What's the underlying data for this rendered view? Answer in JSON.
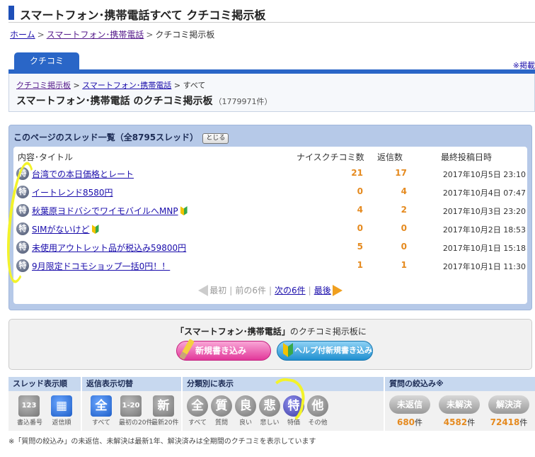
{
  "page": {
    "title": "スマートフォン･携帯電話すべて クチコミ掲示板"
  },
  "breadcrumb": {
    "home": "ホーム",
    "category": "スマートフォン･携帯電話",
    "current": "クチコミ掲示板",
    "sep": ">"
  },
  "tab": {
    "label": "クチコミ",
    "right_link": "※掲載"
  },
  "board": {
    "crumb_board": "クチコミ掲示板",
    "crumb_category": "スマートフォン･携帯電話",
    "crumb_all": "すべて",
    "title": "スマートフォン･携帯電話 のクチコミ掲示板",
    "count": "（1779971件）"
  },
  "thread_panel": {
    "title": "このページのスレッド一覧（全8795スレッド）",
    "close_label": "とじる",
    "headers": {
      "content": "内容･タイトル",
      "nice": "ナイスクチコミ数",
      "reply": "返信数",
      "last_post": "最終投稿日時"
    },
    "badge": "特",
    "threads": [
      {
        "title": "台湾での本日価格とレート",
        "beginner": false,
        "nice": "21",
        "reply": "17",
        "date": "2017年10月5日 23:10"
      },
      {
        "title": "イートレンド8580円",
        "beginner": false,
        "nice": "0",
        "reply": "4",
        "date": "2017年10月4日 07:47"
      },
      {
        "title": "秋葉原ヨドバシでワイモバイルへMNP",
        "beginner": true,
        "nice": "4",
        "reply": "2",
        "date": "2017年10月3日 23:20"
      },
      {
        "title": "SIMがないけど",
        "beginner": true,
        "nice": "0",
        "reply": "0",
        "date": "2017年10月2日 18:53"
      },
      {
        "title": "未使用アウトレット品が税込み59800円",
        "beginner": false,
        "nice": "5",
        "reply": "0",
        "date": "2017年10月1日 15:18"
      },
      {
        "title": "9月限定ドコモショップ一括0円！！",
        "beginner": false,
        "nice": "1",
        "reply": "1",
        "date": "2017年10月1日 11:30"
      }
    ],
    "pager": {
      "first": "最初",
      "prev": "前の6件",
      "next": "次の6件",
      "last": "最後",
      "sep": "|"
    }
  },
  "post_box": {
    "label_bold": "「スマートフォン･携帯電話」",
    "label_rest": "のクチコミ掲示板に",
    "new_post": "新規書き込み",
    "help_post": "ヘルプ付新規書き込み"
  },
  "toolbar": {
    "sort": {
      "head": "スレッド表示順",
      "buttons": [
        {
          "icon": "123",
          "label": "書込番号"
        },
        {
          "icon": "▦",
          "label": "返信順"
        }
      ]
    },
    "reply_view": {
      "head": "返信表示切替",
      "buttons": [
        {
          "icon": "全",
          "label": "すべて"
        },
        {
          "icon": "1-20",
          "label": "最初の20件"
        },
        {
          "icon": "新",
          "label": "最新20件"
        }
      ]
    },
    "category": {
      "head": "分類別に表示",
      "buttons": [
        {
          "icon": "全",
          "label": "すべて"
        },
        {
          "icon": "質",
          "label": "質問"
        },
        {
          "icon": "良",
          "label": "良い"
        },
        {
          "icon": "悲",
          "label": "悲しい"
        },
        {
          "icon": "特",
          "label": "特価"
        },
        {
          "icon": "他",
          "label": "その他"
        }
      ]
    },
    "filter": {
      "head": "質問の絞込み※",
      "pills": [
        {
          "label": "未返信",
          "count": "680",
          "unit": "件"
        },
        {
          "label": "未解決",
          "count": "4582",
          "unit": "件"
        },
        {
          "label": "解決済",
          "count": "72418",
          "unit": "件"
        }
      ]
    }
  },
  "footnote": "※「質問の絞込み」の未返信、未解決は最新1年、解決済みは全期間のクチコミを表示しています",
  "colors": {
    "brand_blue": "#2a66c7",
    "count_orange": "#e58a1f",
    "highlight_yellow": "#f3f32a"
  }
}
